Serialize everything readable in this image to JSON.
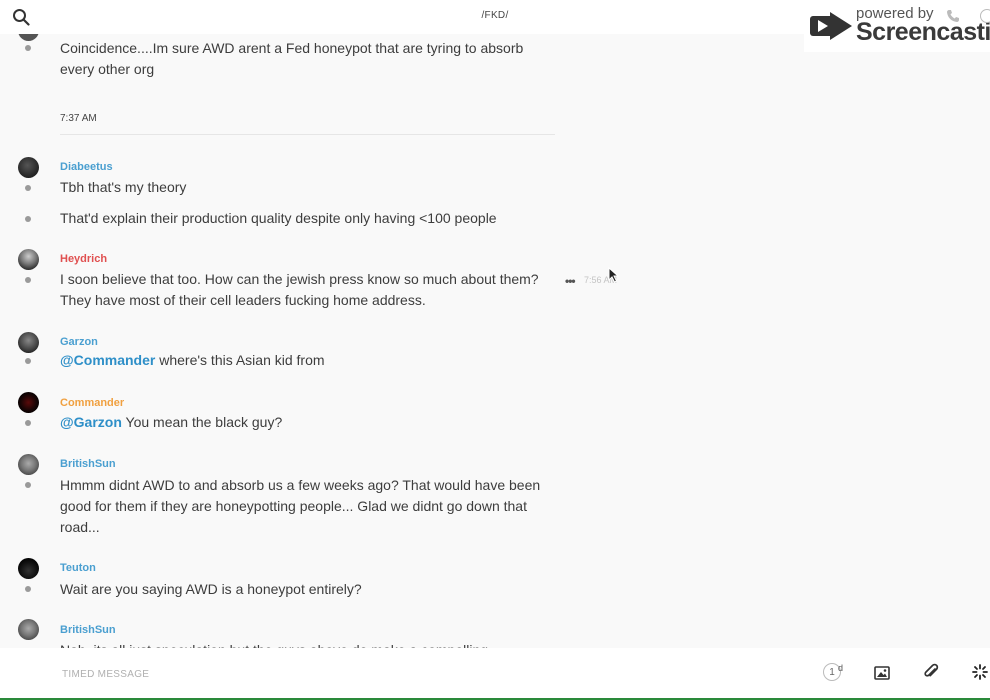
{
  "header": {
    "channel_title": "/FKD/"
  },
  "watermark": {
    "line1": "powered by",
    "line2": "Screencastify"
  },
  "messages": {
    "m0": {
      "text": "Coincidence....Im sure AWD arent a Fed honeypot that are tyring to absorb every other org"
    },
    "time_separator": "7:37 AM",
    "m1": {
      "author": "Diabeetus",
      "author_color": "#4a9fd0",
      "line1": "Tbh that's my theory",
      "line2": "That'd explain their production quality despite only having <100 people"
    },
    "m2": {
      "author": "Heydrich",
      "author_color": "#e05050",
      "text": "I soon believe that too. How can  the jewish press know so much about them? They have most of their cell leaders fucking home address.",
      "more": "•••",
      "hover_time": "7:56 AM"
    },
    "m3": {
      "author": "Garzon",
      "author_color": "#4a9fd0",
      "mention": "@Commander",
      "text": " where's this Asian kid from"
    },
    "m4": {
      "author": "Commander",
      "author_color": "#f0a040",
      "mention": "@Garzon",
      "text": " You mean the black guy?"
    },
    "m5": {
      "author": "BritishSun",
      "author_color": "#4a9fd0",
      "text": "Hmmm didnt AWD to and absorb us a few weeks ago? That would have been good for them if they are honeypotting people...  Glad we didnt go down that road..."
    },
    "m6": {
      "author": "Teuton",
      "author_color": "#4a9fd0",
      "text": "Wait are you saying AWD is a honeypot entirely?"
    },
    "m7": {
      "author": "BritishSun",
      "author_color": "#4a9fd0",
      "text": "Nah, its all just speculation but the guys above do make a compelling"
    }
  },
  "composer": {
    "placeholder": "TIMED MESSAGE",
    "timer_value": "1",
    "timer_unit": "d"
  }
}
